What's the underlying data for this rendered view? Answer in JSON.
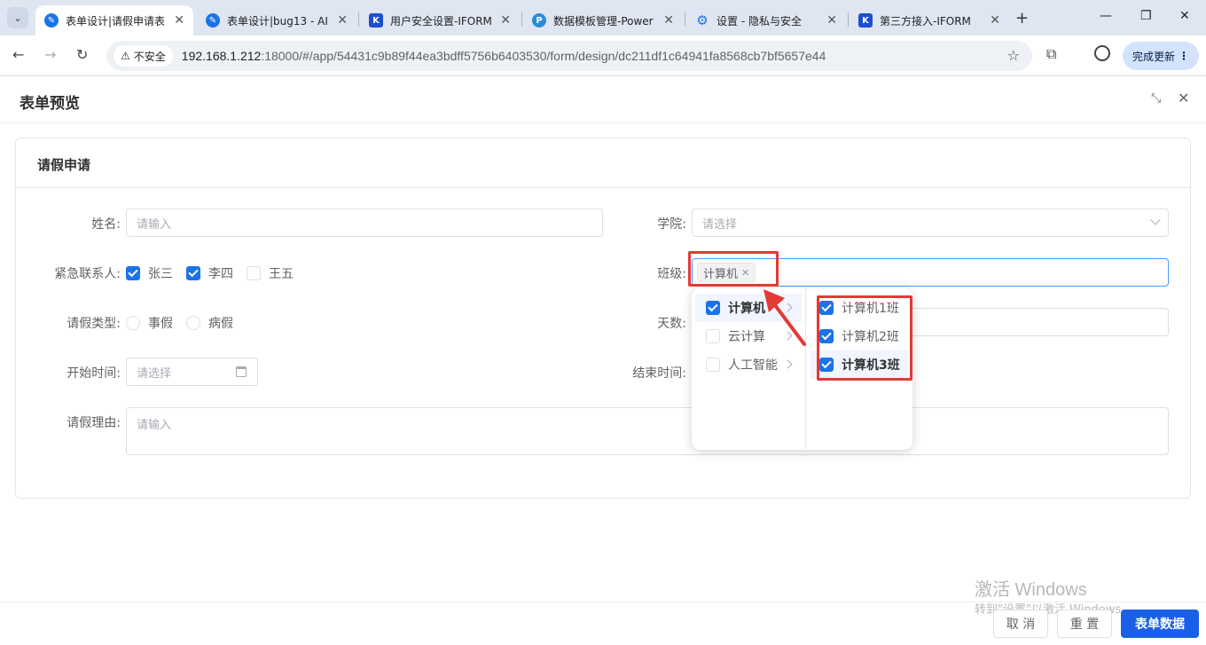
{
  "browser": {
    "tabs": [
      {
        "title": "表单设计|请假申请表",
        "icon": "feather-icon"
      },
      {
        "title": "表单设计|bug13 - AI",
        "icon": "feather-icon"
      },
      {
        "title": "用户安全设置-IFORM",
        "icon": "ak-icon"
      },
      {
        "title": "数据模板管理-Power",
        "icon": "power-icon"
      },
      {
        "title": "设置 - 隐私与安全",
        "icon": "gear-icon"
      },
      {
        "title": "第三方接入-IFORM",
        "icon": "ak-icon"
      }
    ],
    "security_label": "不安全",
    "url_host": "192.168.1.212",
    "url_rest": ":18000/#/app/54431c9b89f44ea3bdff5756b6403530/form/design/dc211df1c64941fa8568cb7bf5657e44",
    "update_label": "完成更新"
  },
  "dialog": {
    "title": "表单预览",
    "form_title": "请假申请"
  },
  "form": {
    "name_label": "姓名:",
    "name_placeholder": "请输入",
    "college_label": "学院:",
    "college_placeholder": "请选择",
    "contact_label": "紧急联系人:",
    "contacts": [
      {
        "label": "张三",
        "checked": true
      },
      {
        "label": "李四",
        "checked": true
      },
      {
        "label": "王五",
        "checked": false
      }
    ],
    "class_label": "班级:",
    "class_tag": "计算机",
    "leave_type_label": "请假类型:",
    "leave_types": [
      "事假",
      "病假"
    ],
    "days_label": "天数:",
    "start_label": "开始时间:",
    "start_placeholder": "请选择",
    "end_label": "结束时间:",
    "reason_label": "请假理由:",
    "reason_placeholder": "请输入"
  },
  "cascader": {
    "level1": [
      {
        "label": "计算机",
        "checked": true
      },
      {
        "label": "云计算",
        "checked": false
      },
      {
        "label": "人工智能",
        "checked": false
      }
    ],
    "level2": [
      {
        "label": "计算机1班",
        "checked": true
      },
      {
        "label": "计算机2班",
        "checked": true
      },
      {
        "label": "计算机3班",
        "checked": true
      }
    ]
  },
  "watermark": {
    "line1": "激活 Windows",
    "line2": "转到\"设置\"以激活 Windows。"
  },
  "footer": {
    "cancel": "取 消",
    "reset": "重 置",
    "submit": "表单数据"
  },
  "colors": {
    "accent": "#1a73e8",
    "highlight": "#e53935"
  }
}
